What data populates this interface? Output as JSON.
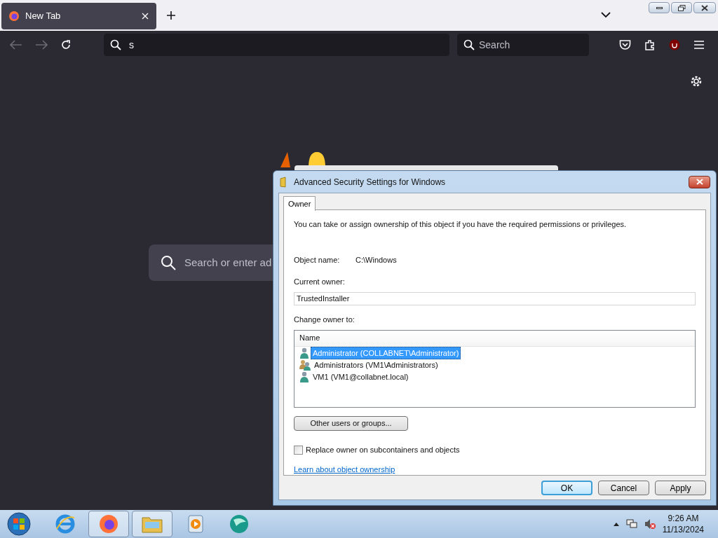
{
  "browser": {
    "tab": {
      "title": "New Tab"
    },
    "address": {
      "value": "s"
    },
    "search": {
      "placeholder": "Search"
    },
    "newtab_search": {
      "placeholder": "Search or enter ad"
    }
  },
  "dialog": {
    "title": "Advanced Security Settings for Windows",
    "tabs": [
      {
        "label": "Owner",
        "selected": true
      }
    ],
    "intro": "You can take or assign ownership of this object if you have the required permissions or privileges.",
    "object_name_label": "Object name:",
    "object_name": "C:\\Windows",
    "current_owner_label": "Current owner:",
    "current_owner": "TrustedInstaller",
    "change_owner_label": "Change owner to:",
    "columns": [
      "Name"
    ],
    "rows": [
      {
        "name": "Administrator (COLLABNET\\Administrator)",
        "kind": "user",
        "selected": true
      },
      {
        "name": "Administrators (VM1\\Administrators)",
        "kind": "group",
        "selected": false
      },
      {
        "name": "VM1 (VM1@collabnet.local)",
        "kind": "user",
        "selected": false
      }
    ],
    "other_button": "Other users or groups...",
    "replace": {
      "label": "Replace owner on subcontainers and objects",
      "checked": false
    },
    "link": "Learn about object ownership",
    "buttons": [
      {
        "label": "OK",
        "default": true
      },
      {
        "label": "Cancel",
        "default": false
      },
      {
        "label": "Apply",
        "default": false
      }
    ]
  },
  "taskbar": {
    "apps": [
      {
        "kind": "ie",
        "running": false
      },
      {
        "kind": "firefox",
        "running": true
      },
      {
        "kind": "explorer",
        "running": true
      },
      {
        "kind": "media",
        "running": false
      },
      {
        "kind": "globe",
        "running": false
      }
    ],
    "time": "9:26 AM",
    "date": "11/13/2024"
  }
}
